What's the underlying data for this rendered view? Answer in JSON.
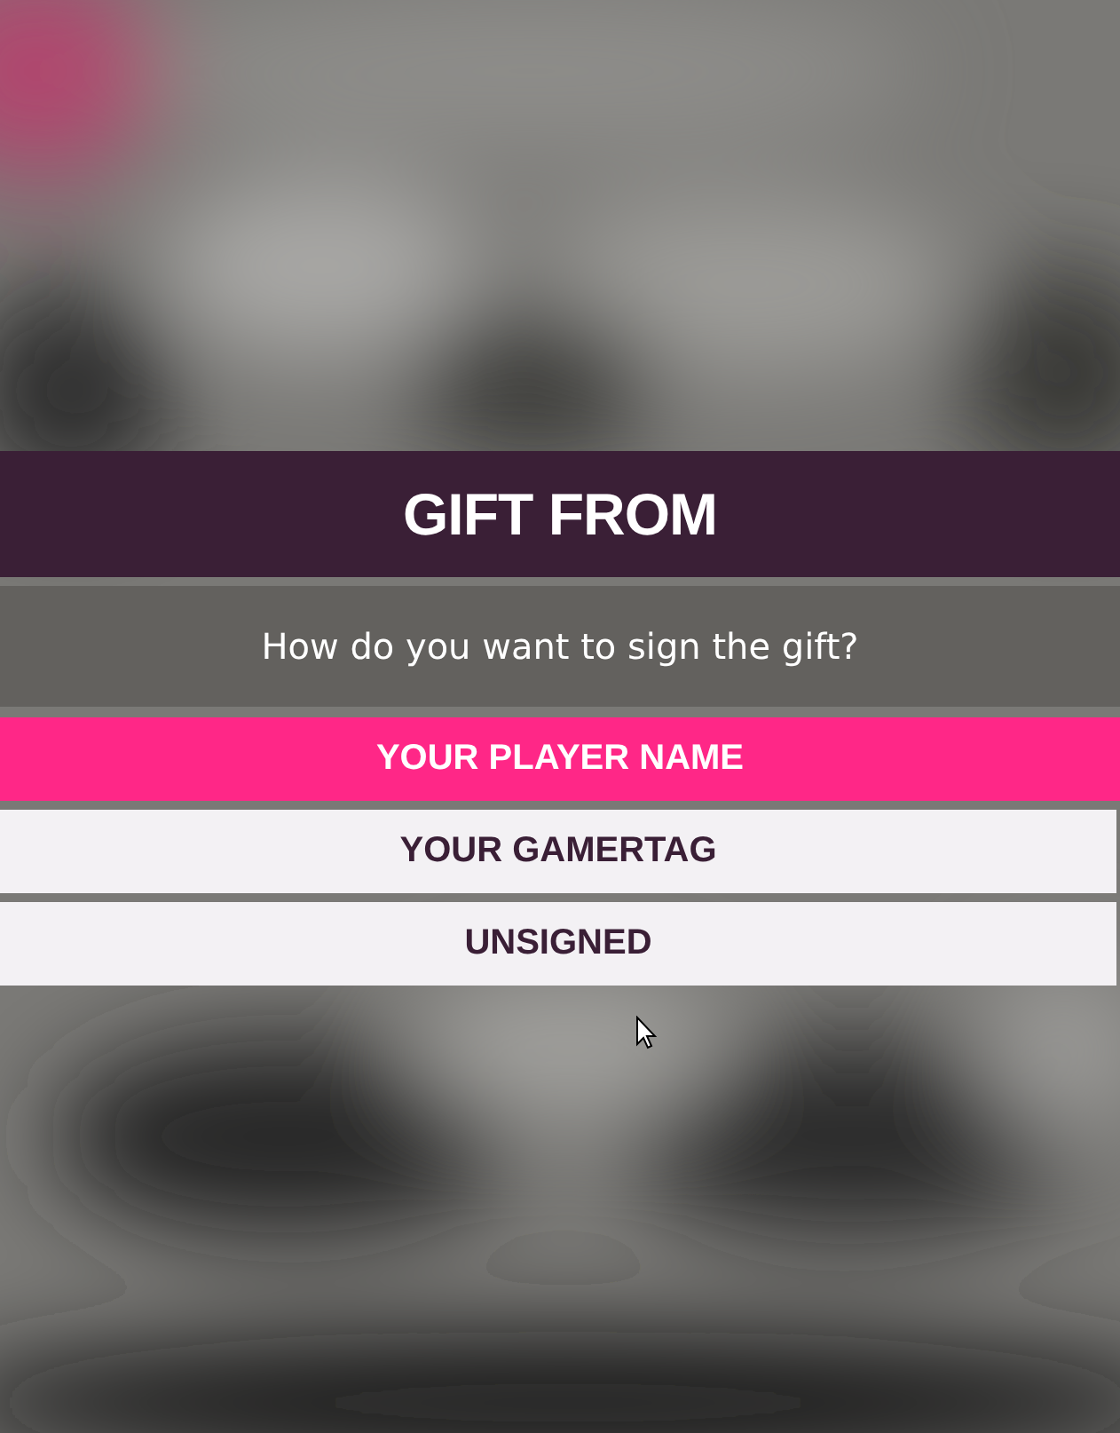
{
  "dialog": {
    "title": "GIFT FROM",
    "prompt": "How do you want to sign the gift?",
    "options": [
      {
        "label": "YOUR PLAYER NAME",
        "selected": true
      },
      {
        "label": "YOUR GAMERTAG",
        "selected": false
      },
      {
        "label": "UNSIGNED",
        "selected": false
      }
    ]
  }
}
